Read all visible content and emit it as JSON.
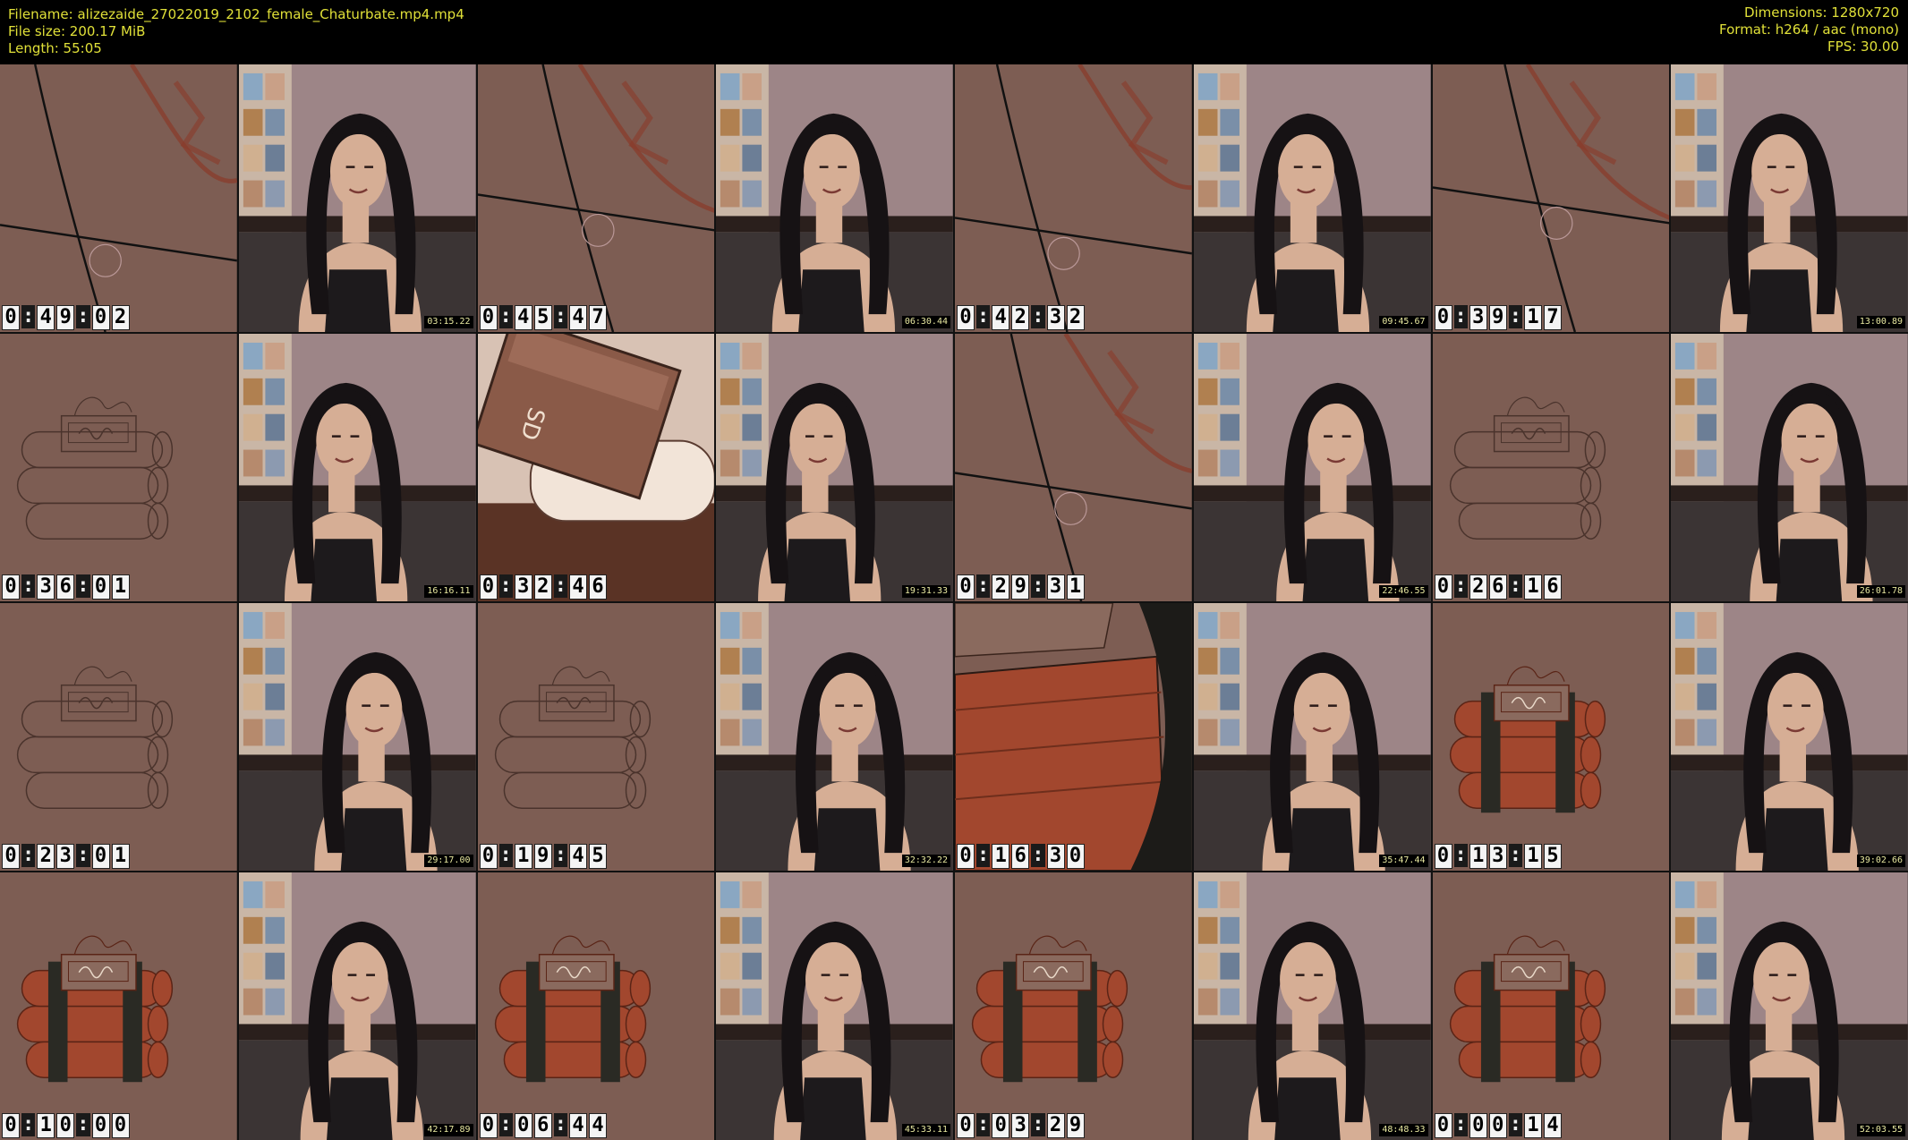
{
  "header": {
    "filename_label": "Filename: alizezaide_27022019_2102_female_Chaturbate.mp4.mp4",
    "filesize_label": "File size: 200.17 MiB",
    "length_label": "Length: 55:05",
    "dimensions_label": "Dimensions: 1280x720",
    "format_label": "Format: h264 / aac (mono)",
    "fps_label": "FPS: 30.00"
  },
  "colors": {
    "meta_text": "#e0e038",
    "canvas_brown": "#7d5d53",
    "dynamite_red": "#a2472e",
    "tape_dark": "#2a2a24",
    "room_wall": "#9d8587",
    "hair": "#161214",
    "skin": "#d6ae95"
  },
  "thumbnails": [
    {
      "kind": "drawing",
      "scene": "sketch-lines",
      "timecode": "0:49:02"
    },
    {
      "kind": "webcam",
      "timestamp": "03:15.22"
    },
    {
      "kind": "drawing",
      "scene": "sketch-lines",
      "timecode": "0:45:47"
    },
    {
      "kind": "webcam",
      "timestamp": "06:30.44"
    },
    {
      "kind": "drawing",
      "scene": "sketch-lines",
      "timecode": "0:42:32"
    },
    {
      "kind": "webcam",
      "timestamp": "09:45.67"
    },
    {
      "kind": "drawing",
      "scene": "sketch-lines",
      "timecode": "0:39:17"
    },
    {
      "kind": "webcam",
      "timestamp": "13:00.89"
    },
    {
      "kind": "drawing",
      "scene": "dynamite-outline",
      "timecode": "0:36:01"
    },
    {
      "kind": "webcam",
      "timestamp": "16:16.11"
    },
    {
      "kind": "drawing",
      "scene": "sd-card",
      "timecode": "0:32:46"
    },
    {
      "kind": "webcam",
      "timestamp": "19:31.33"
    },
    {
      "kind": "drawing",
      "scene": "sketch-lines",
      "timecode": "0:29:31"
    },
    {
      "kind": "webcam",
      "timestamp": "22:46.55"
    },
    {
      "kind": "drawing",
      "scene": "dynamite-outline",
      "timecode": "0:26:16"
    },
    {
      "kind": "webcam",
      "timestamp": "26:01.78"
    },
    {
      "kind": "drawing",
      "scene": "dynamite-outline",
      "timecode": "0:23:01"
    },
    {
      "kind": "webcam",
      "timestamp": "29:17.00"
    },
    {
      "kind": "drawing",
      "scene": "dynamite-outline",
      "timecode": "0:19:45"
    },
    {
      "kind": "webcam",
      "timestamp": "32:32.22"
    },
    {
      "kind": "drawing",
      "scene": "dynamite-closeup",
      "timecode": "0:16:30"
    },
    {
      "kind": "webcam",
      "timestamp": "35:47.44"
    },
    {
      "kind": "drawing",
      "scene": "dynamite-colored",
      "timecode": "0:13:15"
    },
    {
      "kind": "webcam",
      "timestamp": "39:02.66"
    },
    {
      "kind": "drawing",
      "scene": "dynamite-colored",
      "timecode": "0:10:00"
    },
    {
      "kind": "webcam",
      "timestamp": "42:17.89"
    },
    {
      "kind": "drawing",
      "scene": "dynamite-colored",
      "timecode": "0:06:44"
    },
    {
      "kind": "webcam",
      "timestamp": "45:33.11"
    },
    {
      "kind": "drawing",
      "scene": "dynamite-colored",
      "timecode": "0:03:29"
    },
    {
      "kind": "webcam",
      "timestamp": "48:48.33"
    },
    {
      "kind": "drawing",
      "scene": "dynamite-colored",
      "timecode": "0:00:14"
    },
    {
      "kind": "webcam",
      "timestamp": "52:03.55"
    }
  ]
}
